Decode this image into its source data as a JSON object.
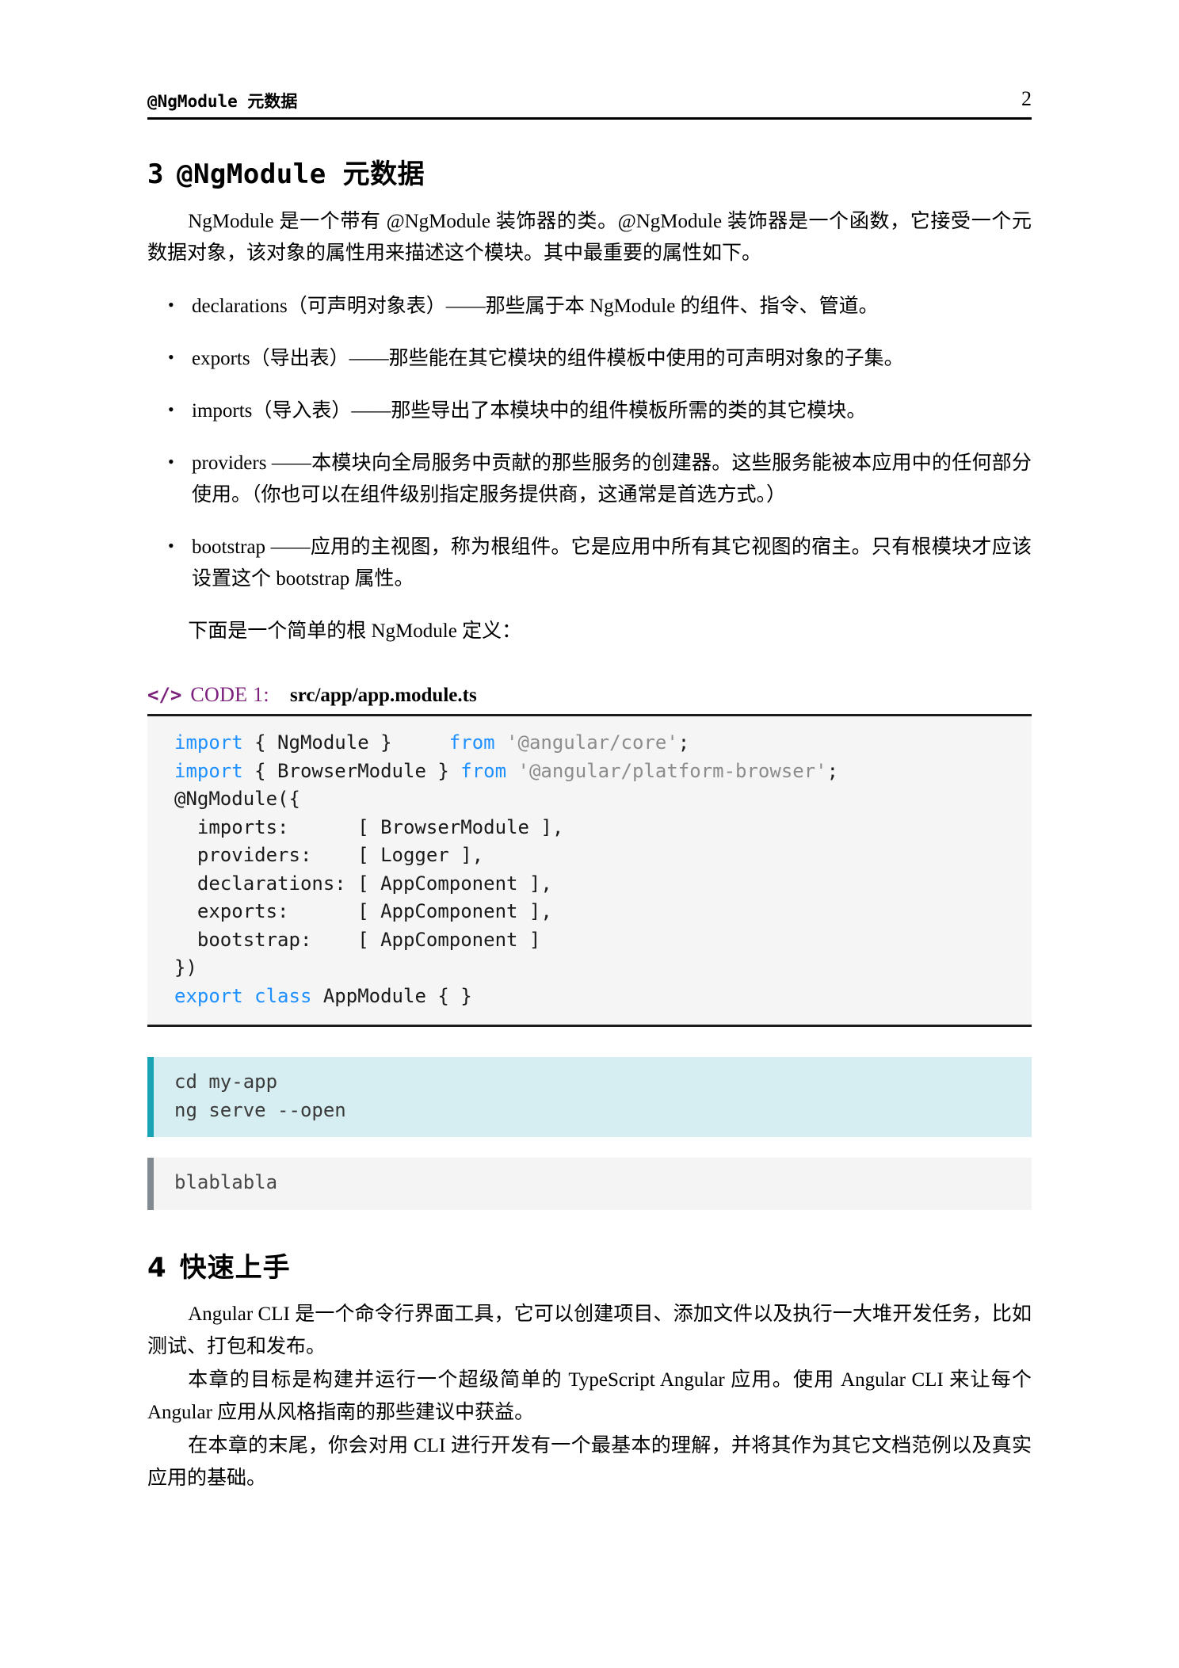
{
  "header": {
    "title": "@NgModule 元数据",
    "page_number": "2"
  },
  "sections": [
    {
      "number": "3",
      "title": "@NgModule 元数据"
    },
    {
      "number": "4",
      "title": "快速上手"
    }
  ],
  "intro_paragraph": "NgModule 是一个带有 @NgModule 装饰器的类。@NgModule 装饰器是一个函数，它接受一个元数据对象，该对象的属性用来描述这个模块。其中最重要的属性如下。",
  "bullets": [
    {
      "marker": "•",
      "text": "declarations（可声明对象表）——那些属于本 NgModule 的组件、指令、管道。"
    },
    {
      "marker": "•",
      "text": "exports（导出表）——那些能在其它模块的组件模板中使用的可声明对象的子集。"
    },
    {
      "marker": "•",
      "text": "imports（导入表）——那些导出了本模块中的组件模板所需的类的其它模块。"
    },
    {
      "marker": "•",
      "text": "providers ——本模块向全局服务中贡献的那些服务的创建器。这些服务能被本应用中的任何部分使用。（你也可以在组件级别指定服务提供商，这通常是首选方式。）"
    },
    {
      "marker": "•",
      "text": "bootstrap ——应用的主视图，称为根组件。它是应用中所有其它视图的宿主。只有根模块才应该设置这个 bootstrap 属性。"
    }
  ],
  "lead_in": "下面是一个简单的根 NgModule 定义：",
  "code_caption": {
    "icon": "code-tags-icon",
    "icon_glyph": "</>",
    "label": "CODE 1:",
    "filename": "src/app/app.module.ts",
    "accent_color": "#7b1f7b"
  },
  "code_block": {
    "language": "typescript",
    "background": "#f5f5f5",
    "keyword_color": "#1e90ff",
    "string_color": "#8c8c8c",
    "lines": [
      "import { NgModule }     from '@angular/core';",
      "import { BrowserModule } from '@angular/platform-browser';",
      "@NgModule({",
      "  imports:      [ BrowserModule ],",
      "  providers:    [ Logger ],",
      "  declarations: [ AppComponent ],",
      "  exports:      [ AppComponent ],",
      "  bootstrap:    [ AppComponent ]",
      "})",
      "export class AppModule { }"
    ]
  },
  "shell_block": {
    "background": "#d6eef1",
    "border_color": "#1aa3b5",
    "lines": [
      "cd my-app",
      "ng serve --open"
    ]
  },
  "note_block": {
    "background": "#f4f4f4",
    "border_color": "#808a90",
    "lines": [
      "blablabla"
    ]
  },
  "section4_paragraphs": [
    "Angular CLI 是一个命令行界面工具，它可以创建项目、添加文件以及执行一大堆开发任务，比如测试、打包和发布。",
    "本章的目标是构建并运行一个超级简单的 TypeScript Angular 应用。使用 Angular CLI 来让每个 Angular 应用从风格指南的那些建议中获益。",
    "在本章的末尾，你会对用 CLI 进行开发有一个最基本的理解，并将其作为其它文档范例以及真实应用的基础。"
  ]
}
